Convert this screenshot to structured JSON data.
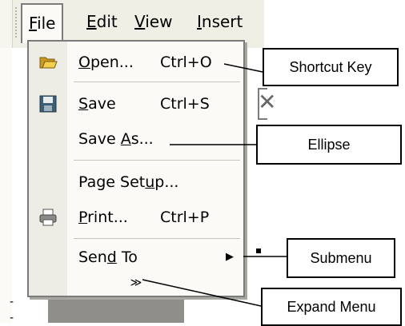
{
  "menubar": {
    "items": [
      {
        "key": "file",
        "pre": "",
        "mn": "F",
        "post": "ile"
      },
      {
        "key": "edit",
        "pre": "",
        "mn": "E",
        "post": "dit"
      },
      {
        "key": "view",
        "pre": "",
        "mn": "V",
        "post": "iew"
      },
      {
        "key": "insert",
        "pre": "",
        "mn": "I",
        "post": "nsert"
      }
    ]
  },
  "file_menu": {
    "open": {
      "pre": "",
      "mn": "O",
      "post": "pen...",
      "shortcut": "Ctrl+O",
      "icon": "folder-open-icon"
    },
    "save": {
      "pre": "",
      "mn": "S",
      "post": "ave",
      "shortcut": "Ctrl+S",
      "icon": "floppy-disk-icon"
    },
    "save_as": {
      "pre": "Save ",
      "mn": "A",
      "post": "s..."
    },
    "page_setup": {
      "pre": "Page Set",
      "mn": "u",
      "post": "p..."
    },
    "print": {
      "pre": "",
      "mn": "P",
      "post": "rint...",
      "shortcut": "Ctrl+P",
      "icon": "printer-icon"
    },
    "send_to": {
      "pre": "Sen",
      "mn": "d",
      "post": " To"
    },
    "submenu_arrow": "▶",
    "expand_glyph": "≫"
  },
  "callouts": {
    "shortcut_key": "Shortcut Key",
    "ellipse": "Ellipse",
    "submenu": "Submenu",
    "expand_menu": "Expand Menu"
  },
  "ruler": {
    "mark1": "-",
    "mark2": "-"
  }
}
